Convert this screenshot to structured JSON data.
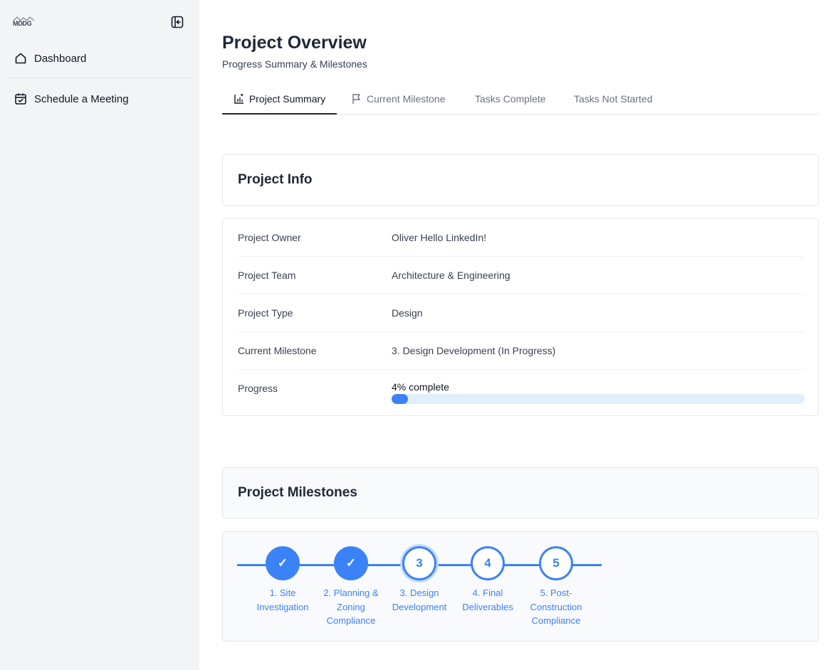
{
  "sidebar": {
    "logo_text": "MDDG",
    "items": [
      {
        "label": "Dashboard",
        "icon": "home-icon"
      },
      {
        "label": "Schedule a Meeting",
        "icon": "calendar-check-icon"
      }
    ]
  },
  "header": {
    "title": "Project Overview",
    "subtitle": "Progress Summary & Milestones"
  },
  "tabs": [
    {
      "label": "Project Summary",
      "icon": "chart-icon",
      "active": true
    },
    {
      "label": "Current Milestone",
      "icon": "flag-icon",
      "active": false
    },
    {
      "label": "Tasks Complete",
      "active": false
    },
    {
      "label": "Tasks Not Started",
      "active": false
    }
  ],
  "project_info": {
    "title": "Project Info",
    "rows": [
      {
        "label": "Project Owner",
        "value": "Oliver Hello LinkedIn!"
      },
      {
        "label": "Project Team",
        "value": "Architecture & Engineering"
      },
      {
        "label": "Project Type",
        "value": "Design"
      },
      {
        "label": "Current Milestone",
        "value": "3. Design Development (In Progress)"
      },
      {
        "label": "Progress",
        "value": "4% complete"
      }
    ],
    "progress_percent": 4
  },
  "milestones": {
    "title": "Project Milestones",
    "steps": [
      {
        "marker": "✓",
        "label": "1. Site Investigation",
        "status": "done"
      },
      {
        "marker": "✓",
        "label": "2. Planning & Zoning Compliance",
        "status": "done"
      },
      {
        "marker": "3",
        "label": "3. Design Development",
        "status": "current"
      },
      {
        "marker": "4",
        "label": "4. Final Deliverables",
        "status": "todo"
      },
      {
        "marker": "5",
        "label": "5. Post-Construction Compliance",
        "status": "todo"
      }
    ]
  },
  "colors": {
    "accent": "#3b82f6",
    "sidebar_bg": "#f3f4f6",
    "progress_track": "#e0effb"
  }
}
